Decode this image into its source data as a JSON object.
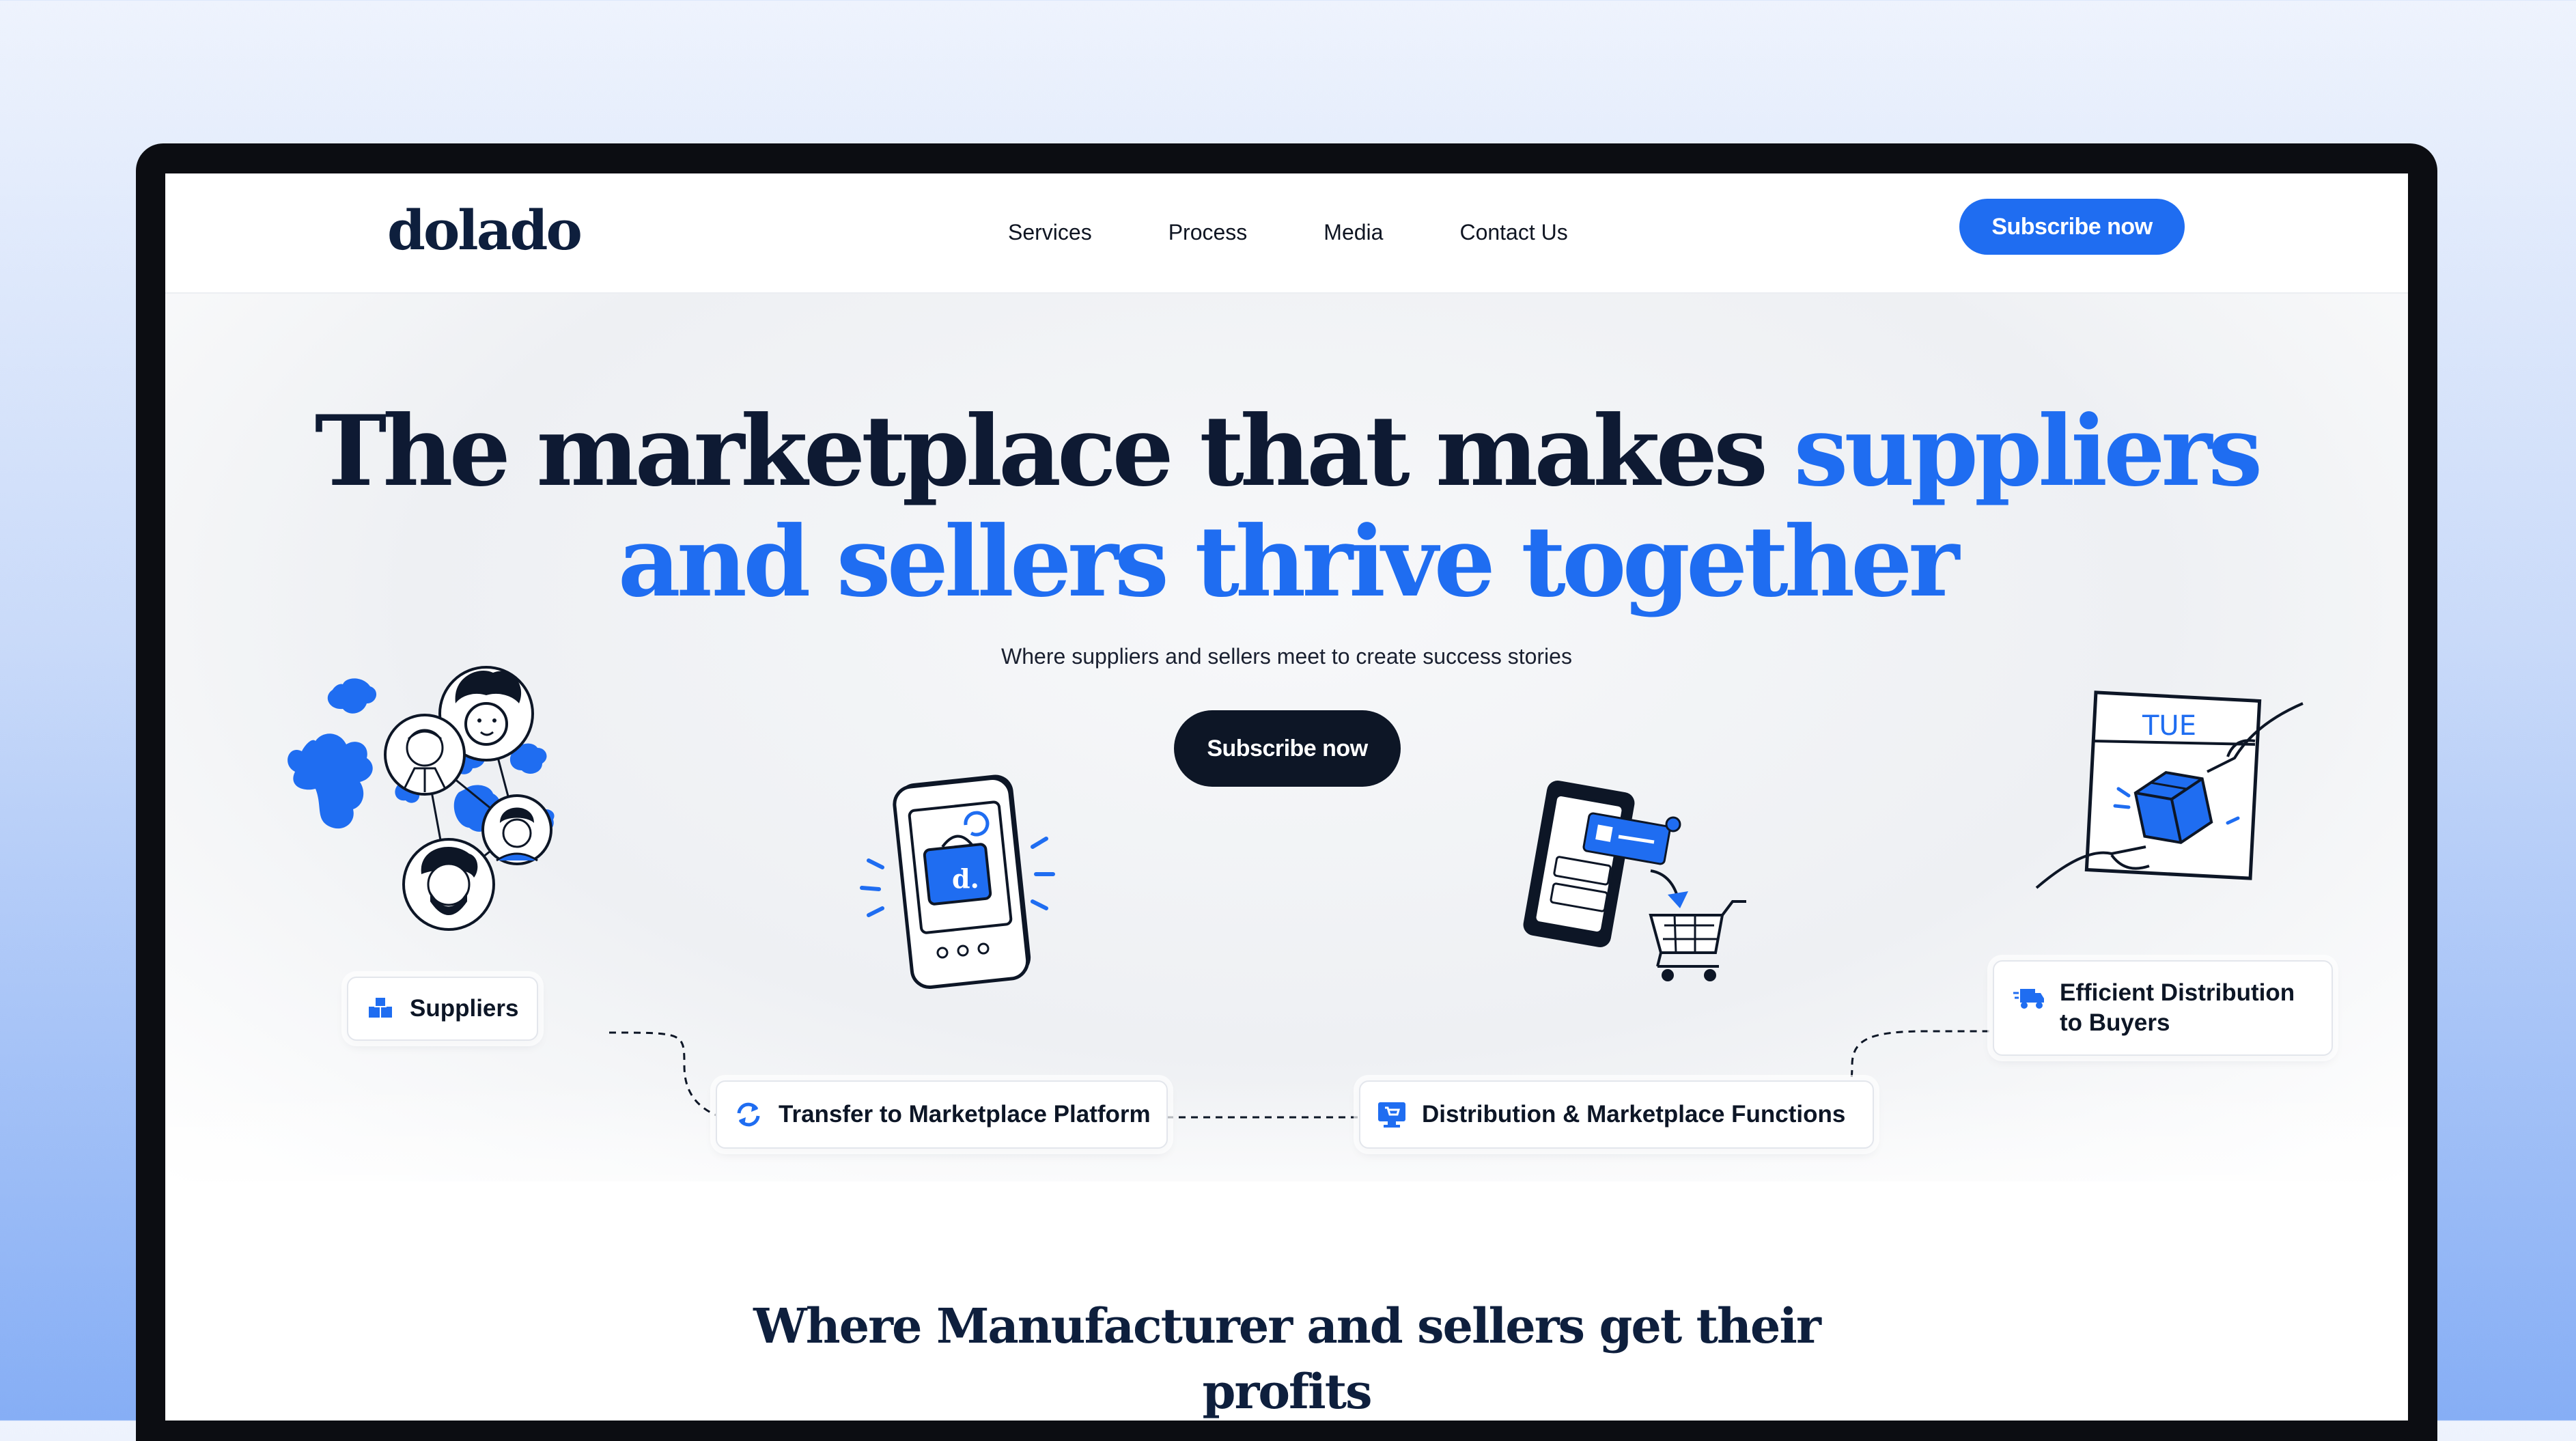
{
  "brand": {
    "logo": "dolado",
    "accent_color": "#1f6df1",
    "dark_color": "#0d1626"
  },
  "nav": {
    "links": [
      "Services",
      "Process",
      "Media",
      "Contact Us"
    ],
    "subscribe_label": "Subscribe now"
  },
  "hero": {
    "headline_part1": "The marketplace that makes ",
    "headline_part2": "suppliers",
    "headline_part3": "and sellers thrive together",
    "subtitle": "Where suppliers and sellers meet to create success stories",
    "cta_label": "Subscribe now"
  },
  "flow": {
    "steps": [
      {
        "label": "Suppliers",
        "icon": "boxes-icon"
      },
      {
        "label": "Transfer to Marketplace Platform",
        "icon": "sync-arrows-icon"
      },
      {
        "label": "Distribution & Marketplace Functions",
        "icon": "monitor-cart-icon"
      },
      {
        "label": "Efficient Distribution to Buyers",
        "line1": "Efficient Distribution",
        "line2": "to Buyers",
        "icon": "delivery-truck-icon"
      }
    ],
    "calendar_day": "TUE",
    "phone_badge": "d."
  },
  "section": {
    "title_line1": "Where Manufacturer and sellers get their",
    "title_line2": "profits"
  }
}
